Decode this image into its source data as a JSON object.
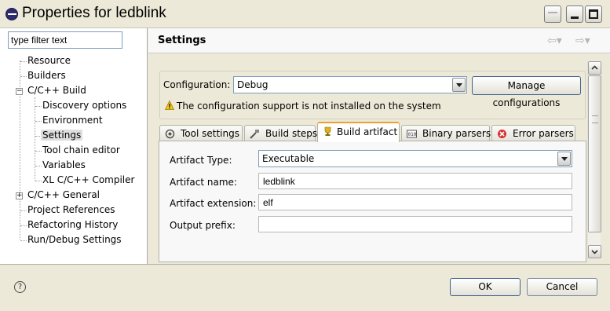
{
  "window": {
    "title": "Properties for ledblink"
  },
  "filter": {
    "value": "type filter text"
  },
  "tree": {
    "items": [
      {
        "label": "Resource"
      },
      {
        "label": "Builders"
      },
      {
        "label": "C/C++ Build",
        "expanded": true
      },
      {
        "label": "Discovery options"
      },
      {
        "label": "Environment"
      },
      {
        "label": "Settings",
        "selected": true
      },
      {
        "label": "Tool chain editor"
      },
      {
        "label": "Variables"
      },
      {
        "label": "XL C/C++ Compiler"
      },
      {
        "label": "C/C++ General",
        "expanded": false
      },
      {
        "label": "Project References"
      },
      {
        "label": "Refactoring History"
      },
      {
        "label": "Run/Debug Settings"
      }
    ]
  },
  "header": {
    "title": "Settings",
    "back_icon": "back-arrow-icon",
    "forward_icon": "forward-arrow-icon"
  },
  "configuration": {
    "label": "Configuration:",
    "value": "Debug",
    "manage_label": "Manage configurations",
    "warning": "The configuration support is not installed on the system"
  },
  "tabs": [
    {
      "label": "Tool settings",
      "icon": "tool-settings-icon"
    },
    {
      "label": "Build steps",
      "icon": "build-steps-icon"
    },
    {
      "label": "Build artifact",
      "icon": "trophy-icon",
      "active": true
    },
    {
      "label": "Binary parsers",
      "icon": "binary-icon"
    },
    {
      "label": "Error parsers",
      "icon": "error-icon"
    }
  ],
  "artifact": {
    "type_label": "Artifact Type:",
    "type_value": "Executable",
    "name_label": "Artifact name:",
    "name_value": "ledblink",
    "extension_label": "Artifact extension:",
    "extension_value": "elf",
    "prefix_label": "Output prefix:",
    "prefix_value": ""
  },
  "buttons": {
    "ok": "OK",
    "cancel": "Cancel"
  },
  "colors": {
    "active_tab_accent": "#f0a030",
    "warning_yellow": "#f5c518"
  }
}
